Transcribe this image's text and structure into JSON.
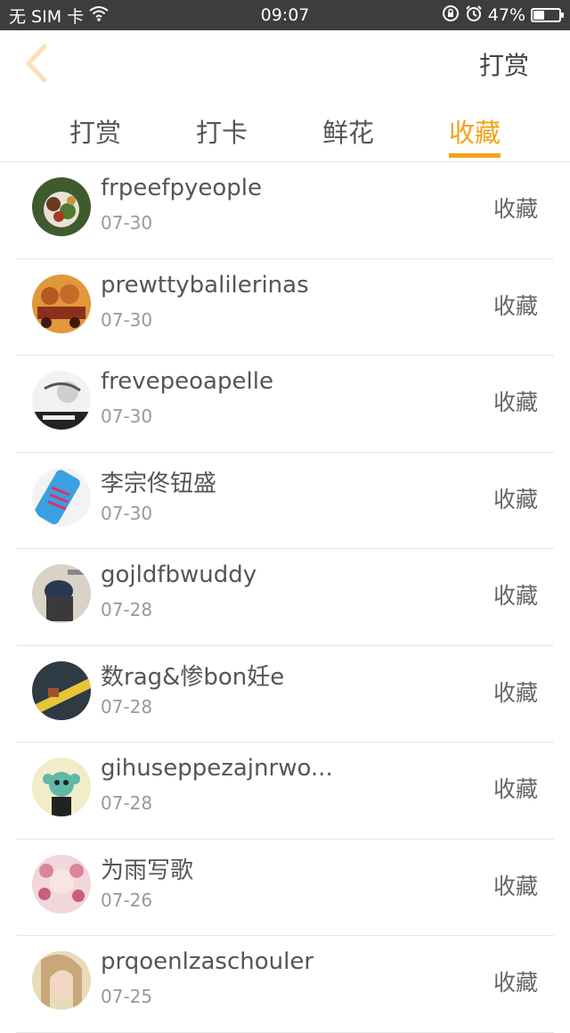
{
  "status_bar": {
    "carrier": "无 SIM 卡",
    "time": "09:07",
    "battery_percent": "47%",
    "battery_level": 0.47,
    "icons": [
      "wifi-icon",
      "screen-lock-rotation-icon",
      "alarm-icon",
      "battery-icon"
    ]
  },
  "header": {
    "back_icon": "chevron-left-icon",
    "action_label": "打赏"
  },
  "tabs": [
    {
      "label": "打赏",
      "active": false
    },
    {
      "label": "打卡",
      "active": false
    },
    {
      "label": "鲜花",
      "active": false
    },
    {
      "label": "收藏",
      "active": true
    }
  ],
  "colors": {
    "accent": "#f2a21b",
    "status_bar_bg": "#3d3d3d"
  },
  "items": [
    {
      "name": "frpeefpyeople",
      "date": "07-30",
      "action": "收藏"
    },
    {
      "name": "prewttybalilerinas",
      "date": "07-30",
      "action": "收藏"
    },
    {
      "name": "frevepeoapelle",
      "date": "07-30",
      "action": "收藏"
    },
    {
      "name": "李宗佟钮盛",
      "date": "07-30",
      "action": "收藏"
    },
    {
      "name": "gojldfbwuddy",
      "date": "07-28",
      "action": "收藏"
    },
    {
      "name": "数rag&惨bon妊e",
      "date": "07-28",
      "action": "收藏"
    },
    {
      "name": "gihuseppezajnrwo...",
      "date": "07-28",
      "action": "收藏"
    },
    {
      "name": "为雨写歌",
      "date": "07-26",
      "action": "收藏"
    },
    {
      "name": "prqoenlzaschouler",
      "date": "07-25",
      "action": "收藏"
    }
  ]
}
